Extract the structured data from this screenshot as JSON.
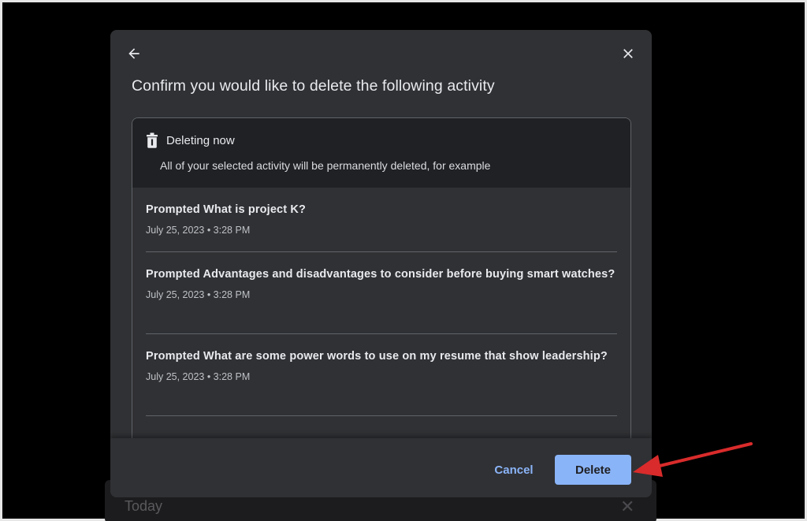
{
  "background": {
    "today_label": "Today"
  },
  "dialog": {
    "title": "Confirm you would like to delete the following activity",
    "back_icon": "arrow-back-icon",
    "close_icon": "close-icon",
    "panel": {
      "heading": "Deleting now",
      "heading_icon": "trash-icon",
      "subtitle": "All of your selected activity will be permanently deleted, for example",
      "entries": [
        {
          "title": "Prompted What is project K?",
          "date": "July 25, 2023 • 3:28 PM"
        },
        {
          "title": "Prompted Advantages and disadvantages to consider before buying smart watches?",
          "date": "July 25, 2023 • 3:28 PM"
        },
        {
          "title": "Prompted What are some power words to use on my resume that show leadership?",
          "date": "July 25, 2023 • 3:28 PM"
        }
      ]
    },
    "buttons": {
      "cancel": "Cancel",
      "delete": "Delete"
    }
  },
  "colors": {
    "accent": "#8ab4f8",
    "dialog_bg": "#303134",
    "annotation_arrow": "#d92b2b"
  }
}
